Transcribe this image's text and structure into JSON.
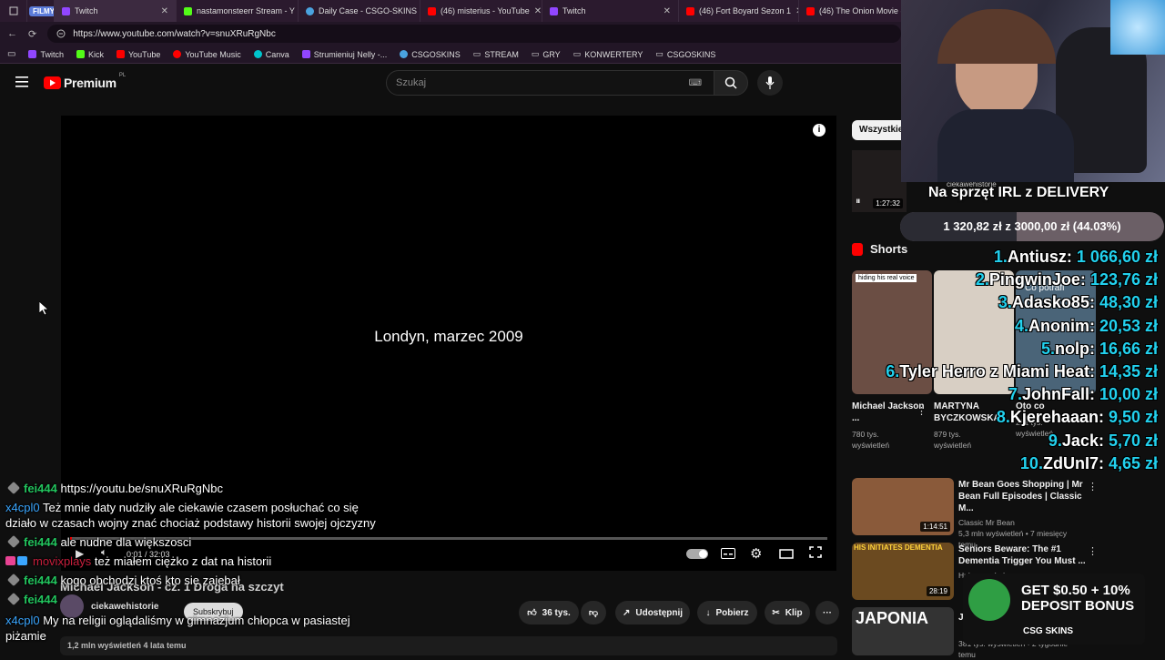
{
  "browser": {
    "tabs": [
      {
        "label": "Twitch",
        "color": "#9146ff",
        "badge": "FILMY"
      },
      {
        "label": "nastamonsteerr Stream - Y",
        "color": "#53fc18"
      },
      {
        "label": "Daily Case - CSGO-SKINS",
        "color": "#4aa3df"
      },
      {
        "label": "(46) misterius - YouTube",
        "color": "#ff0000"
      },
      {
        "label": "Twitch",
        "color": "#9146ff"
      },
      {
        "label": "(46) Fort Boyard Sezon 1",
        "color": "#ff0000"
      },
      {
        "label": "(46) The Onion Movie (W",
        "color": "#ff0000"
      }
    ],
    "url": "https://www.youtube.com/watch?v=snuXRuRgNbc",
    "bookmarks": [
      {
        "label": "Twitch",
        "color": "#9146ff"
      },
      {
        "label": "Kick",
        "color": "#53fc18"
      },
      {
        "label": "YouTube",
        "color": "#ff0000"
      },
      {
        "label": "YouTube Music",
        "color": "#ff0000"
      },
      {
        "label": "Canva",
        "color": "#00c4cc"
      },
      {
        "label": "Strumieniuj Nelly -...",
        "color": "#9146ff"
      },
      {
        "label": "CSGOSKINS",
        "color": "#4aa3df"
      },
      {
        "label": "STREAM",
        "color": "#888888"
      },
      {
        "label": "GRY",
        "color": "#888888"
      },
      {
        "label": "KONWERTERY",
        "color": "#888888"
      },
      {
        "label": "CSGOSKINS",
        "color": "#888888"
      }
    ]
  },
  "youtube": {
    "logo": "Premium",
    "logo_sup": "PL",
    "search_placeholder": "Szukaj",
    "video": {
      "caption": "Londyn, marzec 2009",
      "time": "0:01 / 32:03",
      "title": "Michael Jackson - cz. 1 Droga na szczyt",
      "channel": "ciekawehistorie",
      "subscribe": "Subskrybuj",
      "likes": "36 tys.",
      "share": "Udostępnij",
      "download": "Pobierz",
      "clip": "Klip",
      "meta": "1,2 mln wyświetleń  4 lata temu",
      "progress_fraction": 0.001
    },
    "filter_chip": "Wszystkie",
    "sidebar_top": {
      "channel": "ciekawehistorie",
      "duration": "1:27:32"
    },
    "shorts_label": "Shorts",
    "shorts": [
      {
        "title": "Michael Jackson ...",
        "views": "780 tys.",
        "views2": "wyświetleń",
        "overlay": "hiding his real voice"
      },
      {
        "title": "MARTYNA BYCZKOWSKA",
        "views": "879 tys.",
        "views2": "wyświetleń",
        "overlay": ""
      },
      {
        "title": "Oto co",
        "views": "291 tys.",
        "views2": "wyświetleń",
        "overlay": "Co potrafi"
      }
    ],
    "videos": [
      {
        "title": "Mr Bean Goes Shopping | Mr Bean Full Episodes | Classic M...",
        "channel": "Classic Mr Bean",
        "meta": "5,3 mln wyświetleń • 7 miesięcy temu",
        "duration": "1:14:51",
        "thumb": "#8a5a3a"
      },
      {
        "title": "Seniors Beware: The #1 Dementia Trigger You Must ...",
        "channel": "HubermanLab",
        "meta": "",
        "duration": "28:19",
        "thumb": "#6b4a20",
        "thumb_text": "HIS INITIATES DEMENTIA"
      },
      {
        "title": "J",
        "channel": "",
        "meta": "381 tys. wyświetleń • 2 tygodnie temu",
        "duration": "",
        "thumb": "#333333",
        "thumb_text": "JAPONIA"
      }
    ]
  },
  "chat": [
    {
      "user": "fei444",
      "text": "https://youtu.be/snuXRuRgNbc",
      "ucolor": "u1",
      "badge": true
    },
    {
      "user": "x4cpl0",
      "text": "Też mnie daty nudziły ale ciekawie czasem posłuchać co się",
      "ucolor": "u2",
      "badge": false
    },
    {
      "user": "",
      "text": "działo w czasach wojny znać chociaż podstawy historii swojej ojczyzny",
      "ucolor": "u2",
      "badge": false
    },
    {
      "user": "fei444",
      "text": "ale nudne dla większosci",
      "ucolor": "u1",
      "badge": true
    },
    {
      "user": "movixplays",
      "text": "też miałem ciężko z dat na historii",
      "ucolor": "u3",
      "badge": true
    },
    {
      "user": "fei444",
      "text": "kogo obchodzi ktoś kto się zajebał",
      "ucolor": "u1",
      "badge": true
    },
    {
      "user": "fei444",
      "text": "",
      "ucolor": "u1",
      "badge": true
    },
    {
      "user": "x4cpl0",
      "text": "My na religii oglądaliśmy w gimnazjum chłopca w pasiastej",
      "ucolor": "u2",
      "badge": false
    },
    {
      "user": "",
      "text": "piżamie",
      "ucolor": "u2",
      "badge": false
    }
  ],
  "overlay": {
    "goal_title": "Na sprzęt IRL z DELIVERY",
    "goal_text": "1 320,82 zł  z  3000,00 zł  (44.03%)",
    "goal_fraction": 0.4403,
    "donors": [
      {
        "rank": "1.",
        "name": "Antiusz:",
        "amount": "1 066,60 zł"
      },
      {
        "rank": "2.",
        "name": "PingwinJoe:",
        "amount": "123,76 zł"
      },
      {
        "rank": "3.",
        "name": "Adasko85:",
        "amount": "48,30 zł"
      },
      {
        "rank": "4.",
        "name": "Anonim:",
        "amount": "20,53 zł"
      },
      {
        "rank": "5.",
        "name": "nolp:",
        "amount": "16,66 zł"
      },
      {
        "rank": "6.",
        "name": "Tyler Herro z Miami Heat:",
        "amount": "14,35 zł"
      },
      {
        "rank": "7.",
        "name": "JohnFall:",
        "amount": "10,00 zł"
      },
      {
        "rank": "8.",
        "name": "Kjerehaaan:",
        "amount": "9,50 zł"
      },
      {
        "rank": "9.",
        "name": "Jack:",
        "amount": "5,70 zł"
      },
      {
        "rank": "10.",
        "name": "ZdUnI7:",
        "amount": "4,65 zł"
      }
    ],
    "promo": {
      "line1": "GET $0.50 + 10%",
      "line2": "DEPOSIT BONUS",
      "brand": "CSG SKINS"
    }
  }
}
